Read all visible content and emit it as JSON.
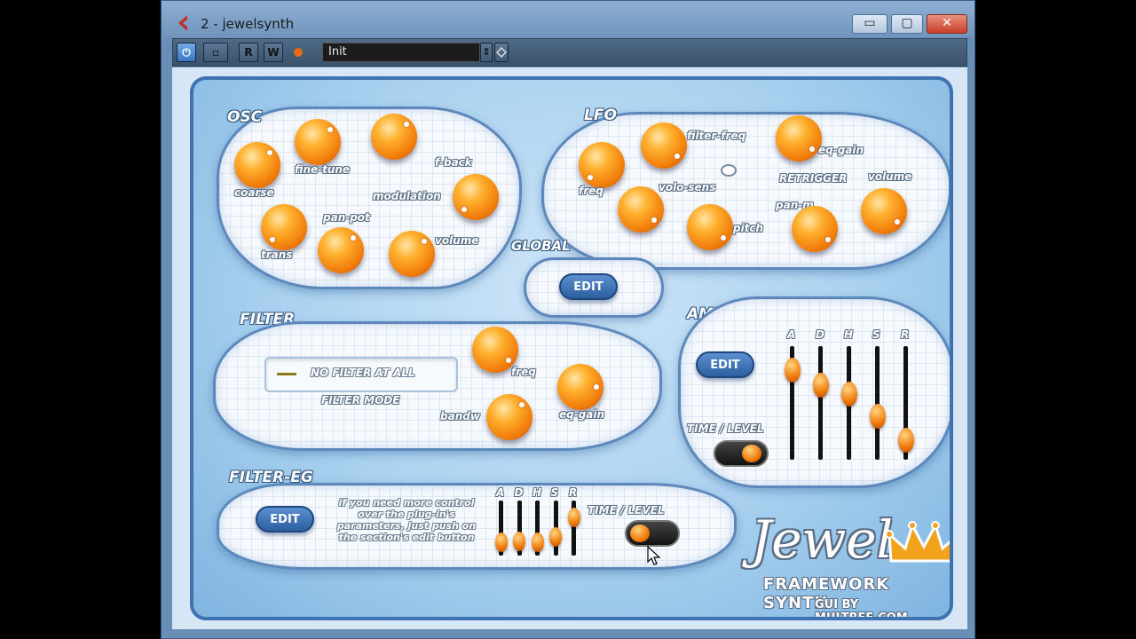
{
  "window": {
    "title": "2 - jewelsynth",
    "min_label": "▭",
    "max_label": "▢",
    "close_label": "✕"
  },
  "toolbar": {
    "power_label": "⏻",
    "bypass_label": "▫",
    "read_label": "R",
    "write_label": "W",
    "preset_name": "Init",
    "arrows_label": "⇕"
  },
  "osc": {
    "title": "OSC",
    "labels": {
      "coarse": "coarse",
      "fine_tune": "fine-tune",
      "trans": "trans",
      "pan_pot": "pan-pot",
      "modulation": "modulation",
      "f_back": "f-back",
      "volume": "volume"
    }
  },
  "lfo": {
    "title": "LFO",
    "labels": {
      "freq": "freq",
      "filter_freq": "filter-freq",
      "eq_gain": "eq-gain",
      "volo_sens": "volo-sens",
      "retrigger": "RETRIGGER",
      "volume": "volume",
      "pan_m": "pan-m",
      "pitch": "pitch"
    }
  },
  "global": {
    "title": "GLOBAL",
    "edit_label": "EDIT"
  },
  "filter": {
    "title": "FILTER",
    "mode_value": "NO FILTER AT ALL",
    "mode_label": "FILTER MODE",
    "labels": {
      "freq": "freq",
      "bandw": "bandw",
      "eq_gain": "eq-gain"
    }
  },
  "amp": {
    "title": "AMP",
    "edit_label": "EDIT",
    "time_level": "TIME / LEVEL",
    "adsr": [
      "A",
      "D",
      "H",
      "S",
      "R"
    ],
    "levels": [
      0.87,
      0.7,
      0.6,
      0.35,
      0.08
    ]
  },
  "filter_eg": {
    "title": "FILTER-EG",
    "edit_label": "EDIT",
    "note": "if you need more control over the plug-in's parameters, just push on the section's edit button",
    "time_level": "TIME / LEVEL",
    "adsr": [
      "A",
      "D",
      "H",
      "S",
      "R"
    ],
    "levels": [
      0.1,
      0.12,
      0.1,
      0.25,
      0.8
    ]
  },
  "logo": {
    "name": "Jewel",
    "subtitle": "FRAMEWORK SYNTH",
    "credit": "GUI BY MULTREE.COM"
  },
  "icons": {
    "app": "cubase-icon",
    "crown": "crown-icon"
  },
  "colors": {
    "knob": "#f08a12",
    "panel": "#a9d1ef",
    "edit_button": "#2c5f9f"
  }
}
